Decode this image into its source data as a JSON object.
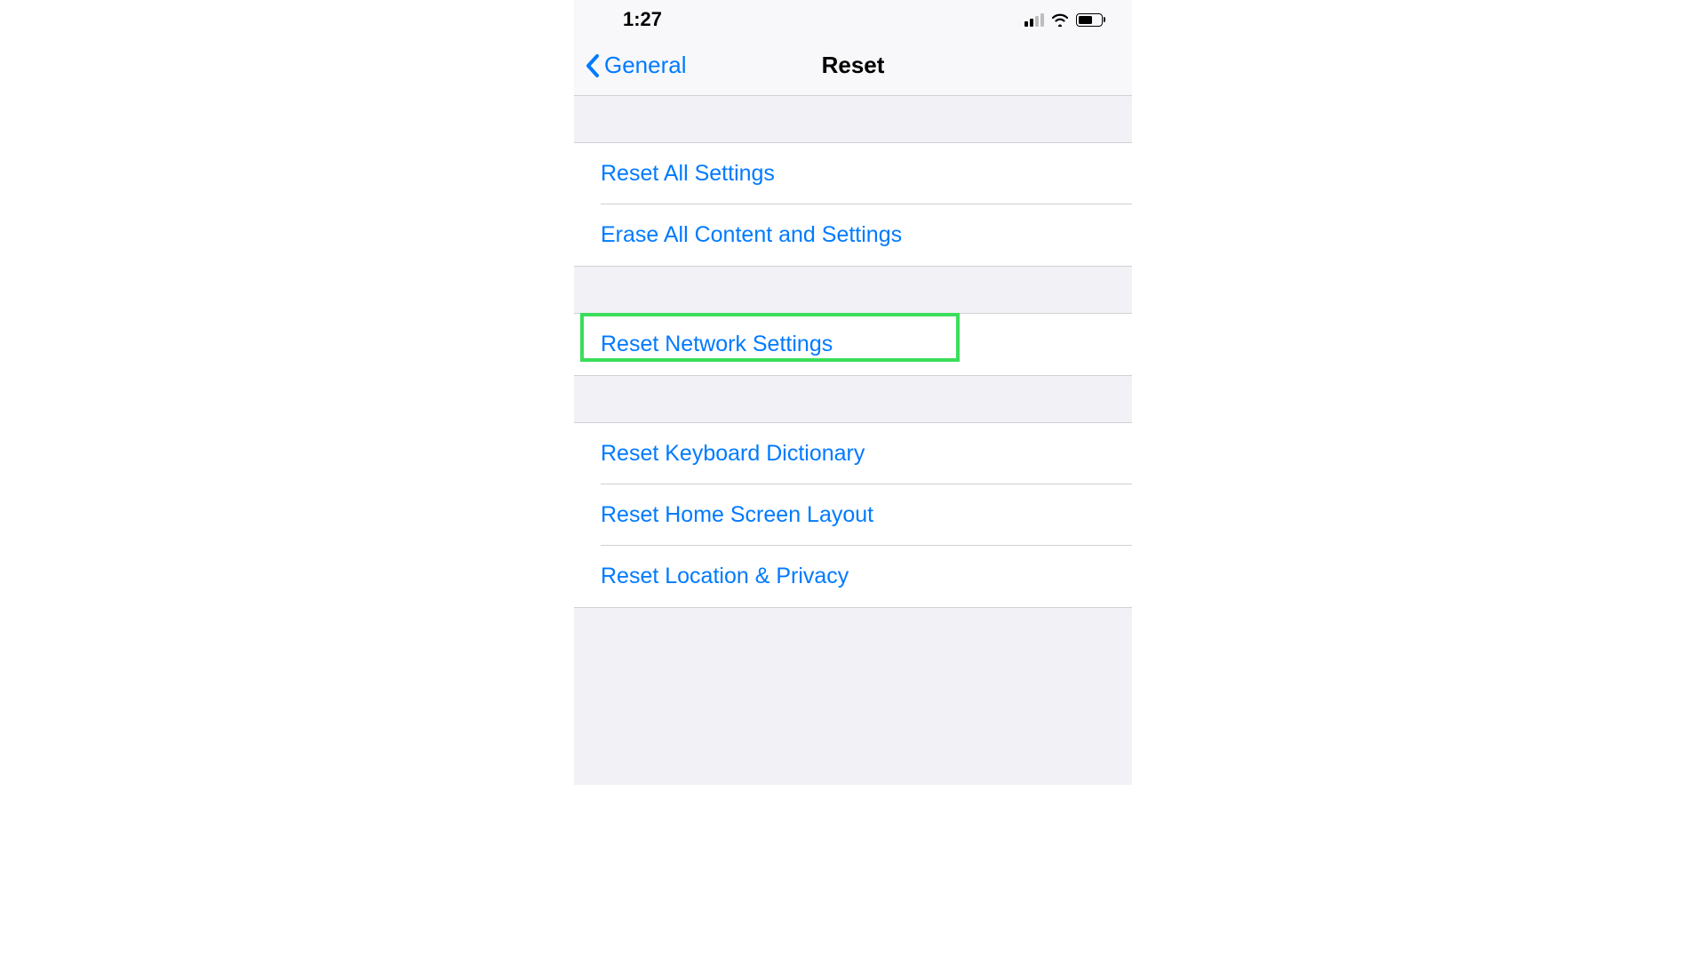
{
  "statusBar": {
    "time": "1:27"
  },
  "nav": {
    "backLabel": "General",
    "title": "Reset"
  },
  "sections": [
    {
      "items": [
        {
          "key": "reset_all",
          "label": "Reset All Settings"
        },
        {
          "key": "erase_all",
          "label": "Erase All Content and Settings"
        }
      ]
    },
    {
      "items": [
        {
          "key": "reset_network",
          "label": "Reset Network Settings",
          "highlighted": true
        }
      ]
    },
    {
      "items": [
        {
          "key": "reset_keyboard",
          "label": "Reset Keyboard Dictionary"
        },
        {
          "key": "reset_homescreen",
          "label": "Reset Home Screen Layout"
        },
        {
          "key": "reset_location",
          "label": "Reset Location & Privacy"
        }
      ]
    }
  ],
  "colors": {
    "link": "#007aff",
    "highlight": "#3ade5b",
    "background": "#f2f1f6"
  }
}
